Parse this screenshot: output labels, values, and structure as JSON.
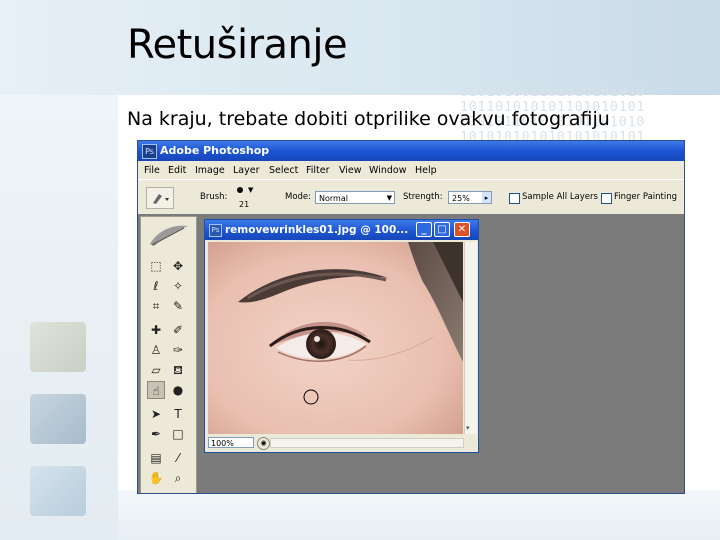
{
  "slide": {
    "title": "Retuširanje",
    "body": "Na kraju, trebate dobiti otprilike ovakvu fotografiju",
    "binary_pattern": "010101001101010101010\n101101010101101010101\n010101101010101101010\n101010101010101010101"
  },
  "photoshop": {
    "app_title": "Adobe Photoshop",
    "menu": [
      "File",
      "Edit",
      "Image",
      "Layer",
      "Select",
      "Filter",
      "View",
      "Window",
      "Help"
    ],
    "options": {
      "brush_label": "Brush:",
      "brush_size": "21",
      "mode_label": "Mode:",
      "mode_value": "Normal",
      "strength_label": "Strength:",
      "strength_value": "25%",
      "sample_all_layers": "Sample All Layers",
      "finger_painting": "Finger Painting"
    },
    "document": {
      "title": "removewrinkles01.jpg @ 100...",
      "zoom": "100%"
    }
  },
  "colors": {
    "xp_title_blue": "#1d55d4",
    "chrome": "#ece9d8",
    "workspace_gray": "#7b7b7b",
    "close_red": "#d9532c"
  },
  "icons": [
    "photoshop-logo-icon",
    "smudge-tool-icon",
    "feather-icon",
    "marquee-tool-icon",
    "move-tool-icon",
    "lasso-tool-icon",
    "magic-wand-icon",
    "crop-tool-icon",
    "slice-tool-icon",
    "healing-brush-icon",
    "brush-tool-icon",
    "clone-stamp-icon",
    "history-brush-icon",
    "eraser-icon",
    "paint-bucket-icon",
    "blur-tool-icon",
    "dodge-tool-icon",
    "path-selection-icon",
    "type-tool-icon",
    "pen-tool-icon",
    "shape-tool-icon",
    "notes-icon",
    "eyedropper-icon",
    "hand-tool-icon",
    "zoom-tool-icon"
  ]
}
